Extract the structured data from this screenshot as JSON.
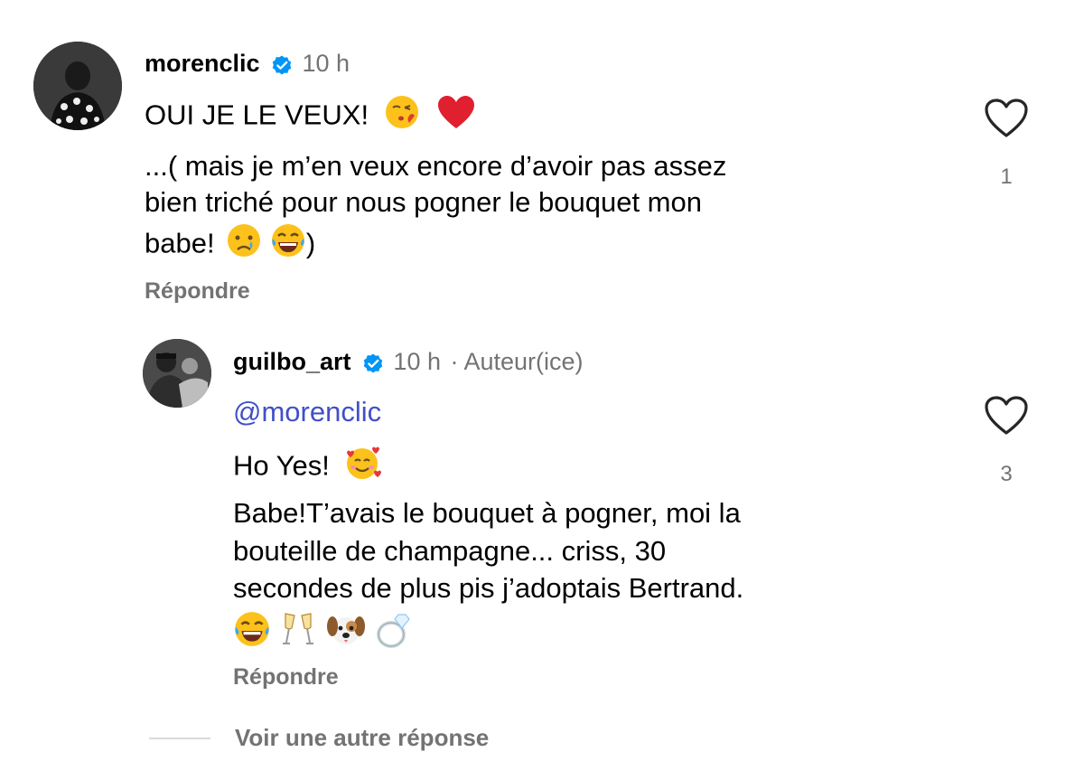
{
  "comments": [
    {
      "username": "morenclic",
      "time": "10 h",
      "line1": "OUI JE LE VEUX!",
      "line2": "...( mais je m’en veux encore d’avoir pas assez",
      "line3": "bien triché pour nous pogner le bouquet mon",
      "line4_prefix": "babe!",
      "line4_suffix": ")",
      "reply_label": "Répondre",
      "likes": "1"
    },
    {
      "username": "guilbo_art",
      "time": "10 h",
      "author_tag": "· Auteur(ice)",
      "mention": "@morenclic",
      "line1": "Ho Yes!",
      "line2": "Babe!T’avais le bouquet à pogner, moi la",
      "line3": "bouteille de champagne... criss, 30",
      "line4": "secondes de plus pis j’adoptais Bertrand.",
      "reply_label": "Répondre",
      "likes": "3"
    }
  ],
  "more_replies_label": "Voir une autre réponse",
  "colors": {
    "verified": "#0095f6",
    "mention": "#4150c7",
    "meta": "#737373"
  },
  "icons": [
    "heart-outline-icon",
    "verified-badge-icon",
    "kiss-emoji-icon",
    "red-heart-emoji-icon",
    "crying-emoji-icon",
    "laughing-emoji-icon",
    "smiling-hearts-emoji-icon",
    "champagne-glasses-emoji-icon",
    "dog-face-emoji-icon",
    "ring-emoji-icon"
  ]
}
